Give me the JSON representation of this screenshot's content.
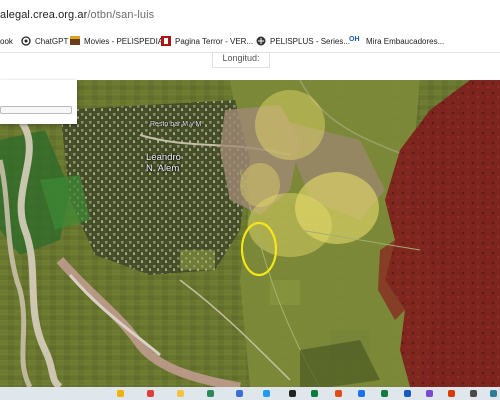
{
  "browser": {
    "url_host": "alegal.crea.org.ar",
    "url_path": "/otbn/san-luis"
  },
  "bookmarks": [
    {
      "label": "ook",
      "icon": "bookmark-partial-icon"
    },
    {
      "label": "ChatGPT",
      "icon": "chatgpt-icon"
    },
    {
      "label": "Movies - PELISPEDIA",
      "icon": "movies-icon"
    },
    {
      "label": "Pagina Terror - VER...",
      "icon": "terror-page-icon"
    },
    {
      "label": "PELISPLUS - Series...",
      "icon": "pelisplus-icon"
    },
    {
      "label": "Mira Embaucadores...",
      "icon": "oh-icon",
      "icon_text": "OH"
    }
  ],
  "map": {
    "coordinate_label": "Longitud:",
    "places": {
      "resto": "Resto bar M y M",
      "town_line1": "Leandro",
      "town_line2": "N. Alem"
    },
    "zone_colors": {
      "red_zone": "#8a1f1f",
      "yellow_zone": "#e8dc6a",
      "highlight_ring": "#f5e61a",
      "river": "#d9d2c4"
    }
  },
  "taskbar": {
    "icons": [
      "app-icon-1",
      "app-icon-2",
      "app-icon-3",
      "app-icon-4",
      "app-icon-5",
      "app-icon-6",
      "app-icon-7",
      "app-icon-8",
      "app-icon-9",
      "app-icon-10",
      "app-icon-11",
      "app-icon-12",
      "app-icon-13",
      "app-icon-14",
      "app-icon-15",
      "app-icon-16"
    ]
  }
}
